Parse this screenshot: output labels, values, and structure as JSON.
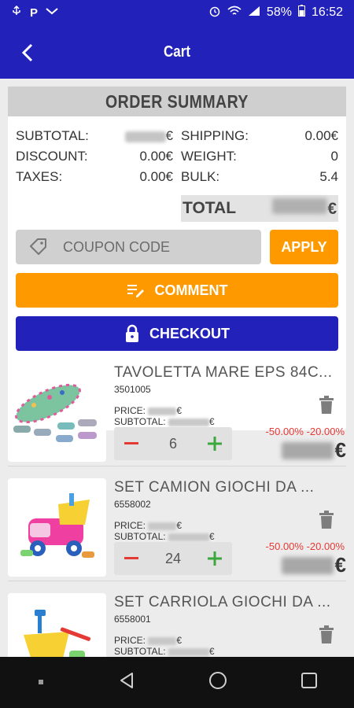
{
  "status_bar": {
    "battery": "58%",
    "time": "16:52"
  },
  "header": {
    "title": "Cart"
  },
  "summary": {
    "title": "ORDER SUMMARY",
    "subtotal_label": "SUBTOTAL:",
    "subtotal_currency": "€",
    "discount_label": "DISCOUNT:",
    "discount_value": "0.00€",
    "taxes_label": "TAXES:",
    "taxes_value": "0.00€",
    "shipping_label": "SHIPPING:",
    "shipping_value": "0.00€",
    "weight_label": "WEIGHT:",
    "weight_value": "0",
    "bulk_label": "BULK:",
    "bulk_value": "5.4",
    "total_label": "TOTAL",
    "total_currency": "€"
  },
  "coupon": {
    "placeholder": "COUPON CODE",
    "apply_label": "APPLY"
  },
  "comment_label": "COMMENT",
  "checkout_label": "CHECKOUT",
  "items": [
    {
      "name": "TAVOLETTA MARE EPS 84C...",
      "code": "3501005",
      "price_label": "PRICE:",
      "subtotal_label": "SUBTOTAL:",
      "currency": "€",
      "quantity": "6",
      "discount": "-50.00% -20.00%"
    },
    {
      "name": "SET CAMION GIOCHI DA ...",
      "code": "6558002",
      "price_label": "PRICE:",
      "subtotal_label": "SUBTOTAL:",
      "currency": "€",
      "quantity": "24",
      "discount": "-50.00% -20.00%"
    },
    {
      "name": "SET CARRIOLA GIOCHI DA ...",
      "code": "6558001",
      "price_label": "PRICE:",
      "subtotal_label": "SUBTOTAL:",
      "currency": "€",
      "quantity": "",
      "discount": ""
    }
  ],
  "colors": {
    "primary": "#2222bb",
    "accent": "#ff9900",
    "danger": "#e53935",
    "success": "#3aa83a"
  }
}
